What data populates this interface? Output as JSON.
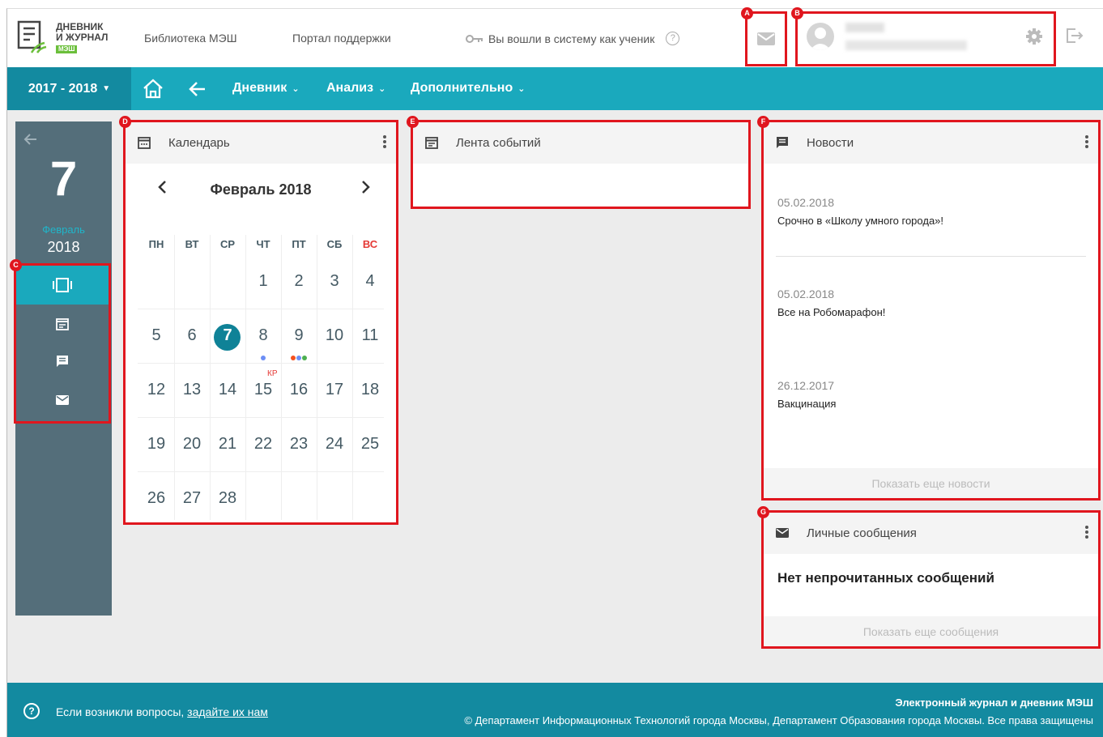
{
  "header": {
    "logo_line1": "ДНЕВНИК",
    "logo_line2": "И ЖУРНАЛ",
    "logo_badge": "МЭШ",
    "library_link": "Библиотека МЭШ",
    "support_link": "Портал поддержки",
    "login_status": "Вы вошли в систему как ученик",
    "help": "?"
  },
  "nav": {
    "year": "2017 - 2018",
    "items": [
      {
        "label": "Дневник"
      },
      {
        "label": "Анализ"
      },
      {
        "label": "Дополнительно"
      }
    ]
  },
  "sidebar": {
    "day": "7",
    "month": "Февраль",
    "year": "2018"
  },
  "calendar": {
    "title": "Календарь",
    "month_label": "Февраль 2018",
    "weekdays": [
      "ПН",
      "ВТ",
      "СР",
      "ЧТ",
      "ПТ",
      "СБ",
      "ВС"
    ],
    "weeks": [
      [
        "",
        "",
        "",
        "1",
        "2",
        "3",
        "4"
      ],
      [
        "5",
        "6",
        "7",
        "8",
        "9",
        "10",
        "11"
      ],
      [
        "12",
        "13",
        "14",
        "15",
        "16",
        "17",
        "18"
      ],
      [
        "19",
        "20",
        "21",
        "22",
        "23",
        "24",
        "25"
      ],
      [
        "26",
        "27",
        "28",
        "",
        "",
        "",
        ""
      ]
    ],
    "today": "7",
    "marker_label": "КР",
    "colors": {
      "accent": "#0f8297",
      "dot_blue": "#6c8ef5",
      "dot_red": "#f4511e",
      "dot_green": "#4caf50"
    }
  },
  "feed": {
    "title": "Лента событий"
  },
  "news": {
    "title": "Новости",
    "items": [
      {
        "date": "05.02.2018",
        "title": "Срочно в «Школу умного города»!"
      },
      {
        "date": "05.02.2018",
        "title": "Все на Робомарафон!"
      },
      {
        "date": "26.12.2017",
        "title": "Вакцинация"
      }
    ],
    "more": "Показать еще новости"
  },
  "messages": {
    "title": "Личные сообщения",
    "empty": "Нет непрочитанных сообщений",
    "more": "Показать еще сообщения"
  },
  "annotations": [
    "A",
    "B",
    "C",
    "D",
    "E",
    "F",
    "G"
  ],
  "footer": {
    "question": "Если возникли вопросы,",
    "question_link": "задайте их нам",
    "title": "Электронный журнал и дневник МЭШ",
    "copyright": "© Департамент Информационных Технологий города Москвы, Департамент Образования города Москвы. Все права защищены"
  }
}
